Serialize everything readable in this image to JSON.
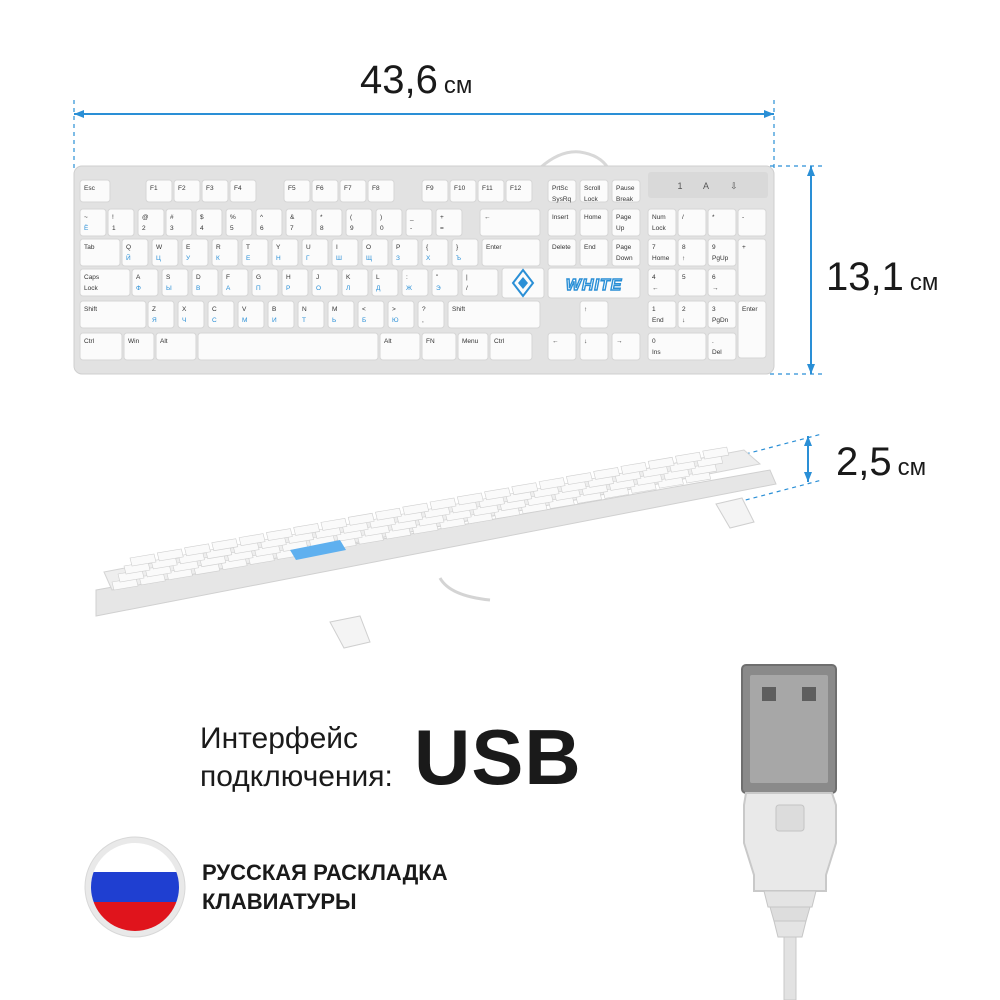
{
  "dimensions": {
    "width": {
      "value": "43,6",
      "unit": "см"
    },
    "height": {
      "value": "13,1",
      "unit": "см"
    },
    "depth": {
      "value": "2,5",
      "unit": "см"
    }
  },
  "keyboard": {
    "logo_text": "WHITE",
    "rows": [
      [
        "Esc",
        "F1",
        "F2",
        "F3",
        "F4",
        "F5",
        "F6",
        "F7",
        "F8",
        "F9",
        "F10",
        "F11",
        "F12",
        "PrtSc SysRq",
        "Scroll Lock",
        "Pause Break"
      ],
      [
        "~ Ё",
        "! 1",
        "@ 2",
        "# 3",
        "$ 4",
        "% 5",
        "^ 6",
        "& 7",
        "* 8",
        "( 9",
        ") 0",
        "_ -",
        "+ =",
        "←",
        "Insert",
        "Home",
        "Page Up",
        "Num Lock",
        "/",
        "*",
        "-"
      ],
      [
        "Tab",
        "Q Й",
        "W Ц",
        "E У",
        "R К",
        "T Е",
        "Y Н",
        "U Г",
        "I Ш",
        "O Щ",
        "P З",
        "{ Х",
        "} Ъ",
        "Enter",
        "Delete",
        "End",
        "Page Down",
        "7 Home",
        "8 ↑",
        "9 PgUp",
        "+"
      ],
      [
        "Caps Lock",
        "A Ф",
        "S Ы",
        "D В",
        "F А",
        "G П",
        "H Р",
        "J О",
        "K Л",
        "L Д",
        ": Ж",
        "\" Э",
        "| /",
        "4 ←",
        "5",
        "6 →"
      ],
      [
        "Shift",
        "Z Я",
        "X Ч",
        "C С",
        "V М",
        "B И",
        "N Т",
        "M Ь",
        "< Б",
        "> Ю",
        "? ,",
        "Shift",
        "↑",
        "1 End",
        "2 ↓",
        "3 PgDn",
        "Enter"
      ],
      [
        "Ctrl",
        "Win",
        "Alt",
        "",
        "Alt",
        "FN",
        "Menu",
        "Ctrl",
        "←",
        "↓",
        "→",
        "0 Ins",
        ". Del"
      ]
    ],
    "indicators": [
      "1",
      "A",
      "⇩"
    ]
  },
  "interface": {
    "label_line1": "Интерфейс",
    "label_line2": "подключения:",
    "value": "USB"
  },
  "layout_note": {
    "line1": "РУССКАЯ РАСКЛАДКА",
    "line2": "КЛАВИАТУРЫ"
  },
  "colors": {
    "dimension_line": "#2a8fd6",
    "keyboard_body": "#e2e2e2",
    "key": "#fbfbfb",
    "cyrillic_legend": "#2a8fd6",
    "flag_white": "#ffffff",
    "flag_blue": "#1f3fd1",
    "flag_red": "#e0141c"
  }
}
